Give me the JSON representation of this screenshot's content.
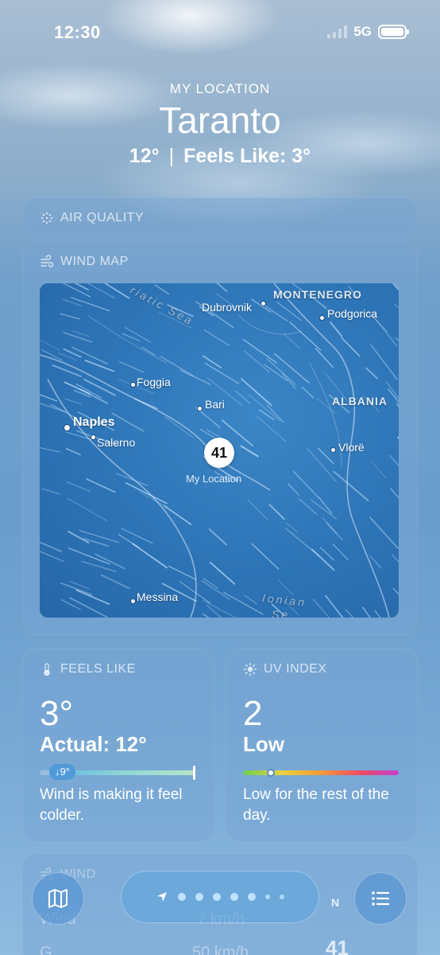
{
  "status_bar": {
    "time": "12:30",
    "network": "5G",
    "battery": "full"
  },
  "header": {
    "location_label": "MY LOCATION",
    "city": "Taranto",
    "temperature": "12°",
    "separator": "|",
    "feels_like": "Feels Like: 3°"
  },
  "air_quality": {
    "title": "AIR QUALITY",
    "icon": "air-quality-icon"
  },
  "wind_map": {
    "title": "WIND MAP",
    "icon": "wind-icon",
    "labels": {
      "montenegro": "MONTENEGRO",
      "dubrovnik": "Dubrovnik",
      "podgorica": "Podgorica",
      "adriatic_sea": "riatic Sea",
      "foggia": "Foggia",
      "bari": "Bari",
      "albania": "ALBANIA",
      "naples": "Naples",
      "salerno": "Salerno",
      "vlore": "Vlorë",
      "messina": "Messina",
      "ionian_sea": "Ionian",
      "ionian_sea_2": "Se"
    },
    "my_location_value": "41",
    "my_location_label": "My Location"
  },
  "feels_like": {
    "title": "FEELS LIKE",
    "icon": "thermometer-icon",
    "value": "3°",
    "actual": "Actual: 12°",
    "chip": "↓9°",
    "description": "Wind is making it feel colder."
  },
  "uv_index": {
    "title": "UV INDEX",
    "icon": "sun-icon",
    "value": "2",
    "level": "Low",
    "level_fraction": 0.18,
    "description": "Low for the rest of the day."
  },
  "wind": {
    "title": "WIND",
    "icon": "wind-icon",
    "faded_left": "Wind",
    "faded_mid": "7 km/h",
    "faded_bottom_left": "G",
    "faded_bottom_mid": "50 km/h"
  },
  "toolbar": {
    "map_icon": "map-icon",
    "location_icon": "location-arrow-icon",
    "list_icon": "list-icon",
    "compass_n": "N",
    "compass_value": "41"
  }
}
